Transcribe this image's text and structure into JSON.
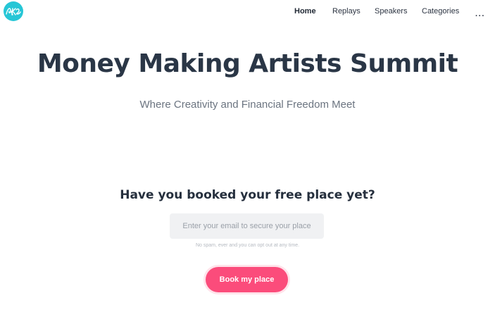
{
  "brand": {
    "logo_text": "RKG",
    "logo_color": "#26c6d6"
  },
  "nav": {
    "items": [
      {
        "label": "Home",
        "active": true
      },
      {
        "label": "Replays",
        "active": false
      },
      {
        "label": "Speakers",
        "active": false
      },
      {
        "label": "Categories",
        "active": false
      }
    ],
    "more_label": "···"
  },
  "hero": {
    "title": "Money Making Artists Summit",
    "subtitle": "Where Creativity and Financial Freedom Meet"
  },
  "signup": {
    "heading": "Have you booked your free place yet?",
    "email_placeholder": "Enter your email to secure your place",
    "email_value": "",
    "disclaimer": "No spam, ever and you can opt out at any time.",
    "button_label": "Book my place",
    "button_color": "#fb4c7b"
  }
}
